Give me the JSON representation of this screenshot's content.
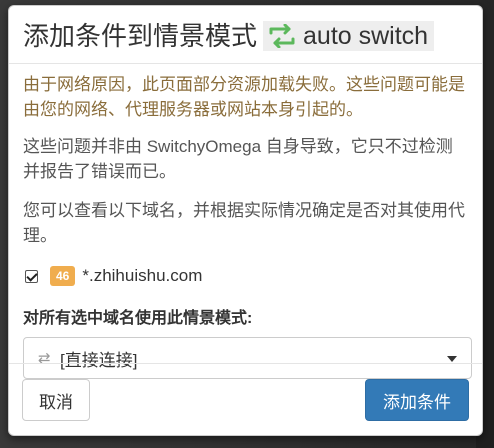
{
  "modal": {
    "title": "添加条件到情景模式",
    "profile_name": "auto switch",
    "profile_icon": "auto-switch-icon",
    "profile_icon_color": "#5cb85c"
  },
  "body": {
    "warning": "由于网络原因，此页面部分资源加载失败。这些问题可能是由您的网络、代理服务器或网站本身引起的。",
    "note1": "这些问题并非由 SwitchyOmega 自身导致，它只不过检测并报告了错误而已。",
    "note2": "您可以查看以下域名，并根据实际情况确定是否对其使用代理。",
    "domains": [
      {
        "checked": true,
        "count": "46",
        "name": "*.zhihuishu.com"
      }
    ],
    "profile_label": "对所有选中域名使用此情景模式:",
    "select": {
      "icon": "exchange-icon",
      "value": "[直接连接]"
    }
  },
  "footer": {
    "cancel_label": "取消",
    "add_label": "添加条件"
  },
  "colors": {
    "warning_text": "#8a6d3b",
    "badge": "#f0ad4e",
    "primary": "#337ab7"
  }
}
